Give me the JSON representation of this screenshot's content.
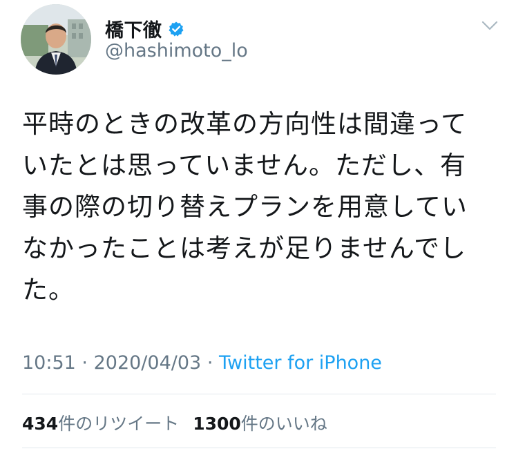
{
  "author": {
    "display_name": "橋下徹",
    "handle": "@hashimoto_lo",
    "verified": true,
    "avatar_icon": "profile-photo"
  },
  "tweet": {
    "text": "平時のときの改革の方向性は間違っていたとは思っていません。ただし、有事の際の切り替えプランを用意していなかったことは考えが足りませんでした。",
    "time": "10:51",
    "separator": "·",
    "date": "2020/04/03",
    "source": "Twitter for iPhone"
  },
  "stats": {
    "retweets_count": "434",
    "retweets_label": "件のリツイート",
    "likes_count": "1300",
    "likes_label": "件のいいね"
  },
  "colors": {
    "text": "#14171a",
    "secondary": "#657786",
    "link": "#1da1f2",
    "verified_badge": "#1da1f2",
    "divider": "#e1e8ed"
  },
  "icons": {
    "verified": "verified-badge-icon",
    "caret": "chevron-down-icon"
  }
}
